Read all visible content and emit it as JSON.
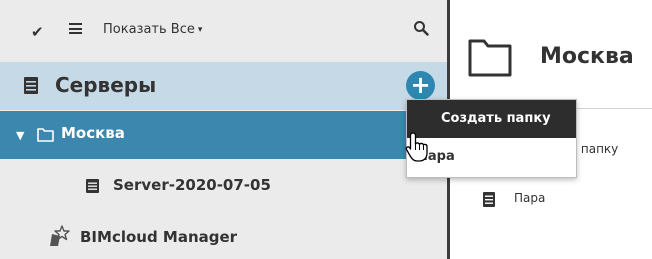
{
  "toolbar": {
    "show_all_label": "Показать Все",
    "caret": "▾",
    "check_glyph": "✔"
  },
  "tree": {
    "root_title": "Серверы",
    "add_glyph": "+",
    "folder_caret": "▼",
    "folder_label": "Москва",
    "server_label": "Server-2020-07-05",
    "manager_label": "BIMcloud Manager"
  },
  "details": {
    "title": "Москва",
    "create_folder_partial": "ь папку",
    "para_label": "Пара"
  },
  "dropdown": {
    "create_folder": "Создать папку",
    "para": "Пара"
  },
  "colors": {
    "selected_row": "#3b87ad",
    "root_row": "#c5d9e6",
    "accent_button": "#2e87b0",
    "menu_highlight": "#2d2d2d"
  }
}
